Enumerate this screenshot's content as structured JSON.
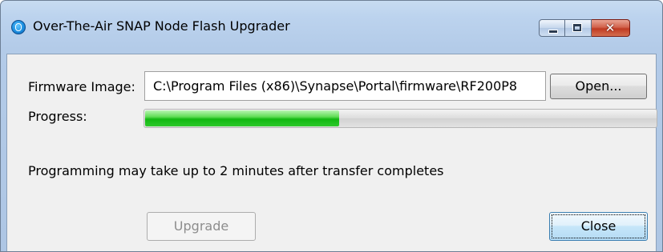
{
  "window": {
    "title": "Over-The-Air SNAP Node Flash Upgrader",
    "icon": "snap-app-icon",
    "controls": {
      "minimize": "minimize-icon",
      "maximize": "maximize-icon",
      "close": "✕"
    }
  },
  "firmware": {
    "label": "Firmware Image:",
    "value": "C:\\Program Files (x86)\\Synapse\\Portal\\firmware\\RF200P8",
    "open_label": "Open..."
  },
  "progress": {
    "label": "Progress:",
    "fraction": 0.38,
    "color": "#12b812"
  },
  "message": "Programming may take up to 2 minutes after transfer completes",
  "buttons": {
    "upgrade_label": "Upgrade",
    "upgrade_enabled": false,
    "close_label": "Close"
  }
}
